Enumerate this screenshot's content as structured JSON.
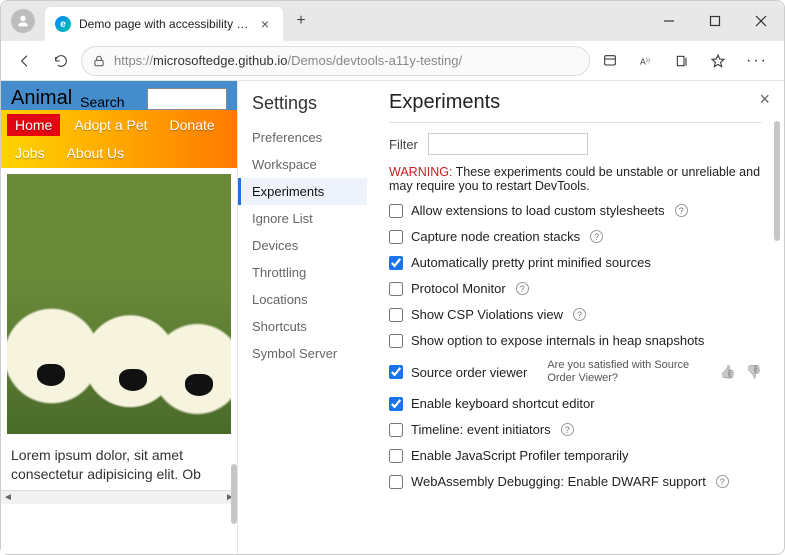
{
  "window": {
    "tab_title": "Demo page with accessibility issu"
  },
  "address": {
    "prefix": "https://",
    "host": "microsoftedge.github.io",
    "path": "/Demos/devtools-a11y-testing/"
  },
  "page": {
    "title": "Animal",
    "search_label": "Search",
    "nav": {
      "home": "Home",
      "adopt": "Adopt a Pet",
      "donate": "Donate",
      "jobs": "Jobs",
      "about": "About Us"
    },
    "lorem": "Lorem ipsum dolor, sit amet consectetur adipisicing elit. Ob"
  },
  "settings": {
    "heading": "Settings",
    "items": [
      "Preferences",
      "Workspace",
      "Experiments",
      "Ignore List",
      "Devices",
      "Throttling",
      "Locations",
      "Shortcuts",
      "Symbol Server"
    ],
    "active_index": 2
  },
  "experiments": {
    "title": "Experiments",
    "filter_label": "Filter",
    "warning_label": "WARNING:",
    "warning_text": "These experiments could be unstable or unreliable and may require you to restart DevTools.",
    "feedback_question": "Are you satisfied with Source Order Viewer?",
    "items": [
      {
        "label": "Allow extensions to load custom stylesheets",
        "checked": false,
        "help": true
      },
      {
        "label": "Capture node creation stacks",
        "checked": false,
        "help": true
      },
      {
        "label": "Automatically pretty print minified sources",
        "checked": true,
        "help": false
      },
      {
        "label": "Protocol Monitor",
        "checked": false,
        "help": true
      },
      {
        "label": "Show CSP Violations view",
        "checked": false,
        "help": true
      },
      {
        "label": "Show option to expose internals in heap snapshots",
        "checked": false,
        "help": false
      },
      {
        "label": "Source order viewer",
        "checked": true,
        "help": false,
        "feedback": true
      },
      {
        "label": "Enable keyboard shortcut editor",
        "checked": true,
        "help": false
      },
      {
        "label": "Timeline: event initiators",
        "checked": false,
        "help": true
      },
      {
        "label": "Enable JavaScript Profiler temporarily",
        "checked": false,
        "help": false
      },
      {
        "label": "WebAssembly Debugging: Enable DWARF support",
        "checked": false,
        "help": true,
        "cutoff": true
      }
    ]
  }
}
